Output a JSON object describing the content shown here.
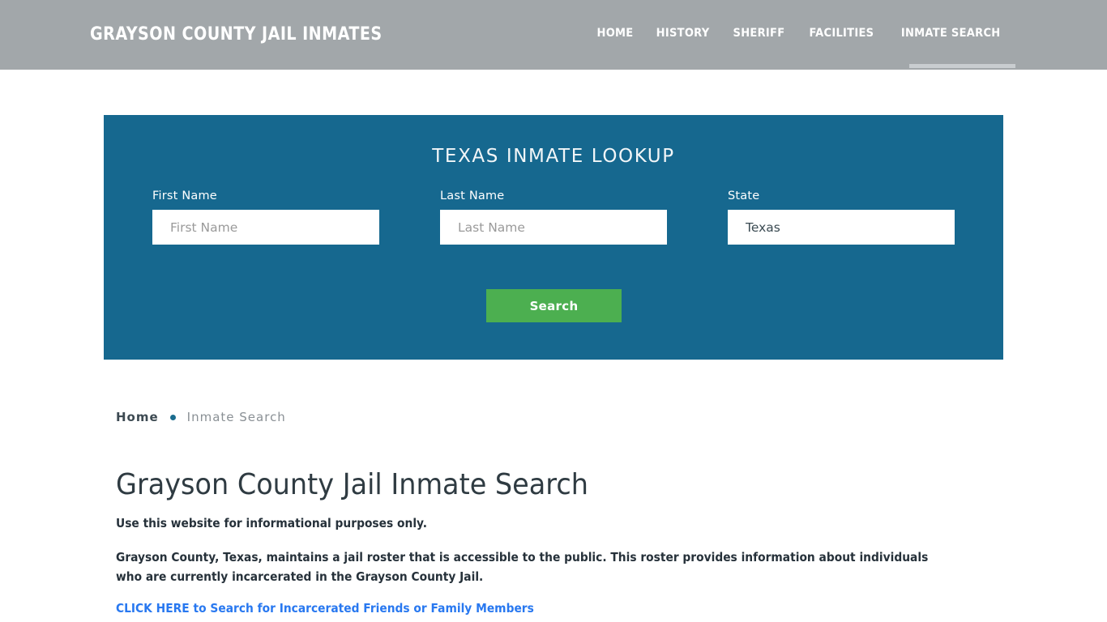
{
  "header": {
    "site_title": "GRAYSON COUNTY JAIL INMATES",
    "nav": [
      {
        "label": "HOME",
        "active": false
      },
      {
        "label": "HISTORY",
        "active": false
      },
      {
        "label": "SHERIFF",
        "active": false
      },
      {
        "label": "FACILITIES",
        "active": false
      },
      {
        "label": "INMATE SEARCH",
        "active": true
      }
    ],
    "background_color": "#a2a7aa",
    "active_indicator_color": "#c9cdd0"
  },
  "lookup_panel": {
    "title": "TEXAS INMATE LOOKUP",
    "background_color": "#16688f",
    "fields": [
      {
        "label": "First Name",
        "placeholder": "First Name",
        "value": ""
      },
      {
        "label": "Last Name",
        "placeholder": "Last Name",
        "value": ""
      },
      {
        "label": "State",
        "placeholder": "",
        "value": "Texas"
      }
    ],
    "submit_label": "Search",
    "submit_color": "#4caf50"
  },
  "breadcrumb": {
    "home_label": "Home",
    "separator": "•",
    "current_label": "Inmate Search",
    "separator_color": "#1a6c8e"
  },
  "main": {
    "heading": "Grayson County Jail Inmate Search",
    "lede": "Use this website for informational purposes only.",
    "paragraph": "Grayson County, Texas, maintains a jail roster that is accessible to the public. This roster provides information about individuals who are currently incarcerated in the Grayson County Jail.",
    "cta_link": "CLICK HERE to Search for Incarcerated Friends or Family Members",
    "cta_color": "#2878f0"
  }
}
